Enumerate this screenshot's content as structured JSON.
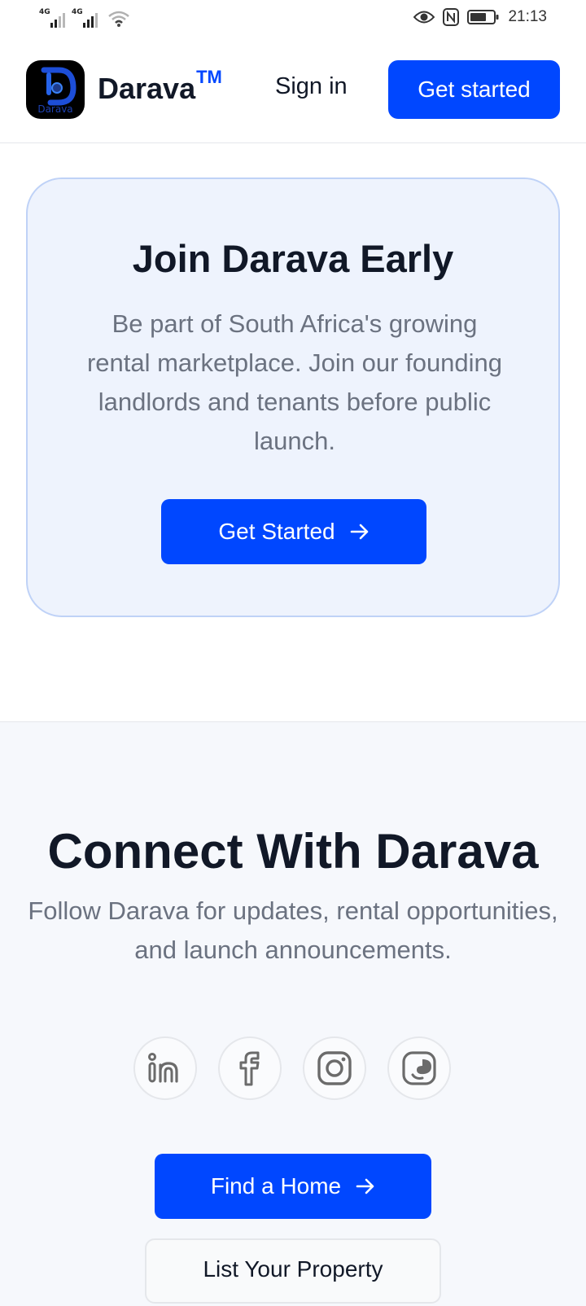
{
  "status_bar": {
    "network_1": "4G",
    "network_2": "4G",
    "time": "21:13",
    "icons": [
      "signal-icon",
      "wifi-icon",
      "eye-icon",
      "nfc-icon",
      "battery-icon"
    ]
  },
  "header": {
    "logo_text": "Darava",
    "brand_name": "Darava",
    "brand_tm": "TM",
    "sign_in_label": "Sign in",
    "get_started_label": "Get started"
  },
  "join": {
    "title": "Join Darava Early",
    "text": "Be part of South Africa's growing rental marketplace. Join our founding landlords and tenants before public launch.",
    "button_label": "Get Started"
  },
  "connect": {
    "title": "Connect With Darava",
    "text": "Follow Darava for updates, rental opportunities, and launch announcements.",
    "socials": [
      "linkedin-icon",
      "facebook-icon",
      "instagram-icon",
      "threads-icon"
    ],
    "find_home_label": "Find a Home",
    "list_property_label": "List Your Property"
  },
  "colors": {
    "accent": "#0047ff",
    "card_bg": "#eef3fd",
    "card_border": "#bfd2f7",
    "section_bg": "#f6f8fc",
    "muted_text": "#6b7280",
    "heading_text": "#111827"
  }
}
